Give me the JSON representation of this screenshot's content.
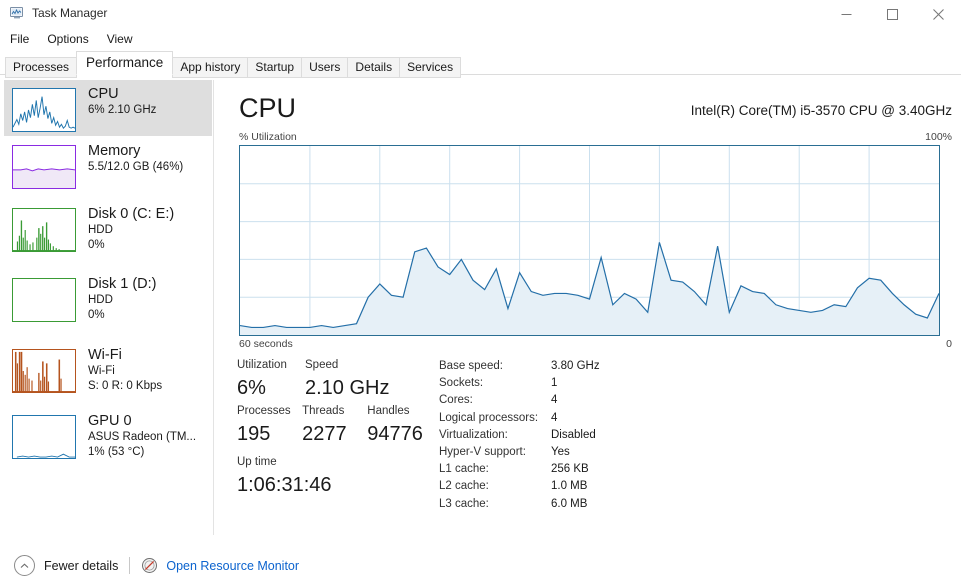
{
  "window": {
    "title": "Task Manager",
    "icon": "task-manager-icon",
    "minimize": "─",
    "maximize": "☐",
    "close": "✕"
  },
  "menu": {
    "items": [
      "File",
      "Options",
      "View"
    ]
  },
  "tabs": {
    "items": [
      "Processes",
      "Performance",
      "App history",
      "Startup",
      "Users",
      "Details",
      "Services"
    ],
    "active": "Performance"
  },
  "sidebar": {
    "items": [
      {
        "name": "CPU",
        "sub1": "6%  2.10 GHz",
        "sub2": "",
        "color": "#1f6fad",
        "selected": true
      },
      {
        "name": "Memory",
        "sub1": "5.5/12.0 GB (46%)",
        "sub2": "",
        "color": "#8a2be2",
        "selected": false
      },
      {
        "name": "Disk 0 (C: E:)",
        "sub1": "HDD",
        "sub2": "0%",
        "color": "#3a9b35",
        "selected": false
      },
      {
        "name": "Disk 1 (D:)",
        "sub1": "HDD",
        "sub2": "0%",
        "color": "#3a9b35",
        "selected": false
      },
      {
        "name": "Wi-Fi",
        "sub1": "Wi-Fi",
        "sub2": "S: 0 R: 0 Kbps",
        "color": "#b5541e",
        "selected": false
      },
      {
        "name": "GPU 0",
        "sub1": "ASUS Radeon (TM...",
        "sub2": "1%  (53 °C)",
        "color": "#2176ae",
        "selected": false
      }
    ]
  },
  "main": {
    "title": "CPU",
    "model": "Intel(R) Core(TM) i5-3570 CPU @ 3.40GHz",
    "axis_top_left": "% Utilization",
    "axis_top_right": "100%",
    "axis_bottom_left": "60 seconds",
    "axis_bottom_right": "0",
    "stats": {
      "utilization_label": "Utilization",
      "utilization_value": "6%",
      "speed_label": "Speed",
      "speed_value": "2.10 GHz",
      "processes_label": "Processes",
      "processes_value": "195",
      "threads_label": "Threads",
      "threads_value": "2277",
      "handles_label": "Handles",
      "handles_value": "94776",
      "uptime_label": "Up time",
      "uptime_value": "1:06:31:46"
    },
    "specs": [
      {
        "key": "Base speed:",
        "value": "3.80 GHz"
      },
      {
        "key": "Sockets:",
        "value": "1"
      },
      {
        "key": "Cores:",
        "value": "4"
      },
      {
        "key": "Logical processors:",
        "value": "4"
      },
      {
        "key": "Virtualization:",
        "value": "Disabled"
      },
      {
        "key": "Hyper-V support:",
        "value": "Yes"
      },
      {
        "key": "L1 cache:",
        "value": "256 KB"
      },
      {
        "key": "L2 cache:",
        "value": "1.0 MB"
      },
      {
        "key": "L3 cache:",
        "value": "6.0 MB"
      }
    ]
  },
  "statusbar": {
    "chevron_icon": "chevron-up-icon",
    "fewer_details": "Fewer details",
    "resource_icon": "resource-monitor-icon",
    "open_resource_monitor": "Open Resource Monitor"
  },
  "colors": {
    "cpu_line": "#246FA8",
    "cpu_fill": "#E6F0F7",
    "grid": "#CBE0EE",
    "border": "#2A6E93",
    "link": "#0b63ce",
    "selection": "#dedede"
  },
  "chart_data": {
    "type": "area",
    "title": "CPU % Utilization",
    "xlabel": "60 seconds",
    "ylabel": "% Utilization",
    "ylim": [
      0,
      100
    ],
    "xlim": [
      60,
      0
    ],
    "grid": true,
    "legend": "none",
    "x": [
      0,
      1,
      2,
      3,
      4,
      5,
      6,
      7,
      8,
      9,
      10,
      11,
      12,
      13,
      14,
      15,
      16,
      17,
      18,
      19,
      20,
      21,
      22,
      23,
      24,
      25,
      26,
      27,
      28,
      29,
      30,
      31,
      32,
      33,
      34,
      35,
      36,
      37,
      38,
      39,
      40,
      41,
      42,
      43,
      44,
      45,
      46,
      47,
      48,
      49,
      50,
      51,
      52,
      53,
      54,
      55,
      56,
      57,
      58,
      59,
      60
    ],
    "values": [
      5,
      4,
      4,
      5,
      4,
      4,
      4,
      5,
      4,
      5,
      6,
      20,
      27,
      21,
      20,
      44,
      46,
      36,
      32,
      40,
      29,
      24,
      35,
      14,
      33,
      23,
      21,
      22,
      22,
      21,
      19,
      41,
      16,
      22,
      19,
      12,
      49,
      29,
      28,
      23,
      16,
      47,
      12,
      26,
      23,
      22,
      16,
      14,
      13,
      12,
      13,
      16,
      15,
      25,
      30,
      29,
      22,
      16,
      11,
      9,
      22
    ]
  }
}
